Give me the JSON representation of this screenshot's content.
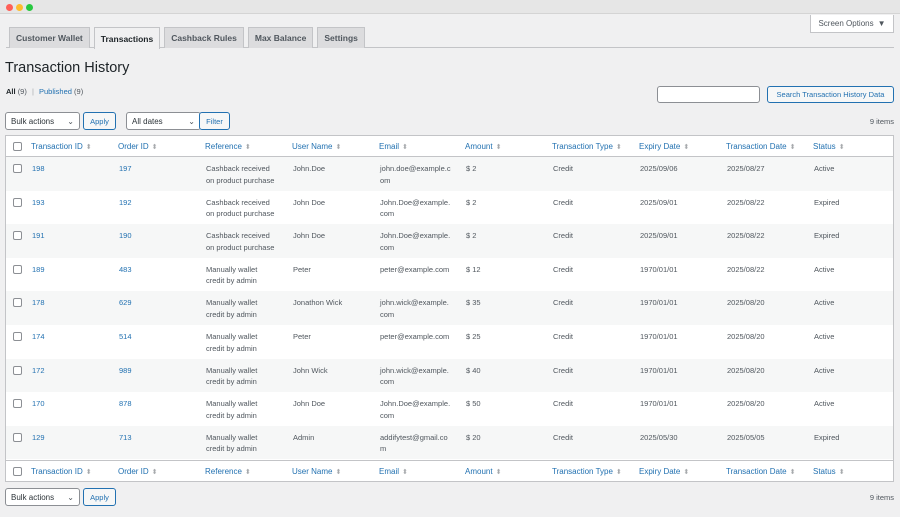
{
  "screen_options": {
    "label": "Screen Options",
    "arrow": "▼"
  },
  "tabs": [
    "Customer Wallet",
    "Transactions",
    "Cashback Rules",
    "Max Balance",
    "Settings"
  ],
  "page_title": "Transaction History",
  "filters": {
    "all_label": "All",
    "all_count": "(9)",
    "published_label": "Published",
    "published_count": "(9)",
    "separator": "|"
  },
  "search": {
    "value": "",
    "button_label": "Search Transaction History Data"
  },
  "bulk_actions": {
    "selected": "Bulk actions",
    "apply_label": "Apply"
  },
  "date_filter": {
    "selected": "All dates",
    "filter_label": "Filter"
  },
  "items_count": "9 items",
  "columns": [
    "Transaction ID",
    "Order ID",
    "Reference",
    "User Name",
    "Email",
    "Amount",
    "Transaction Type",
    "Expiry Date",
    "Transaction Date",
    "Status"
  ],
  "rows": [
    {
      "transaction_id": "198",
      "order_id": "197",
      "reference": "Cashback received\non product purchase",
      "user_name": "John.Doe",
      "email": "john.doe@example.c\nom",
      "amount": "$ 2",
      "type": "Credit",
      "expiry": "2025/09/06",
      "date": "2025/08/27",
      "status": "Active"
    },
    {
      "transaction_id": "193",
      "order_id": "192",
      "reference": "Cashback received\non product purchase",
      "user_name": "John Doe",
      "email": "John.Doe@example.\ncom",
      "amount": "$ 2",
      "type": "Credit",
      "expiry": "2025/09/01",
      "date": "2025/08/22",
      "status": "Expired"
    },
    {
      "transaction_id": "191",
      "order_id": "190",
      "reference": "Cashback received\non product purchase",
      "user_name": "John Doe",
      "email": "John.Doe@example.\ncom",
      "amount": "$ 2",
      "type": "Credit",
      "expiry": "2025/09/01",
      "date": "2025/08/22",
      "status": "Expired"
    },
    {
      "transaction_id": "189",
      "order_id": "483",
      "reference": "Manually wallet\ncredit by admin",
      "user_name": "Peter",
      "email": "peter@example.com",
      "amount": "$ 12",
      "type": "Credit",
      "expiry": "1970/01/01",
      "date": "2025/08/22",
      "status": "Active"
    },
    {
      "transaction_id": "178",
      "order_id": "629",
      "reference": "Manually wallet\ncredit by admin",
      "user_name": "Jonathon Wick",
      "email": "john.wick@example.\ncom",
      "amount": "$ 35",
      "type": "Credit",
      "expiry": "1970/01/01",
      "date": "2025/08/20",
      "status": "Active"
    },
    {
      "transaction_id": "174",
      "order_id": "514",
      "reference": "Manually wallet\ncredit by admin",
      "user_name": "Peter",
      "email": "peter@example.com",
      "amount": "$ 25",
      "type": "Credit",
      "expiry": "1970/01/01",
      "date": "2025/08/20",
      "status": "Active"
    },
    {
      "transaction_id": "172",
      "order_id": "989",
      "reference": "Manually wallet\ncredit by admin",
      "user_name": "John Wick",
      "email": "john.wick@example.\ncom",
      "amount": "$ 40",
      "type": "Credit",
      "expiry": "1970/01/01",
      "date": "2025/08/20",
      "status": "Active"
    },
    {
      "transaction_id": "170",
      "order_id": "878",
      "reference": "Manually wallet\ncredit by admin",
      "user_name": "John Doe",
      "email": "John.Doe@example.\ncom",
      "amount": "$ 50",
      "type": "Credit",
      "expiry": "1970/01/01",
      "date": "2025/08/20",
      "status": "Active"
    },
    {
      "transaction_id": "129",
      "order_id": "713",
      "reference": "Manually wallet\ncredit by admin",
      "user_name": "Admin",
      "email": "addifytest@gmail.co\nm",
      "amount": "$ 20",
      "type": "Credit",
      "expiry": "2025/05/30",
      "date": "2025/05/05",
      "status": "Expired"
    }
  ],
  "sort_glyph": "⬍"
}
